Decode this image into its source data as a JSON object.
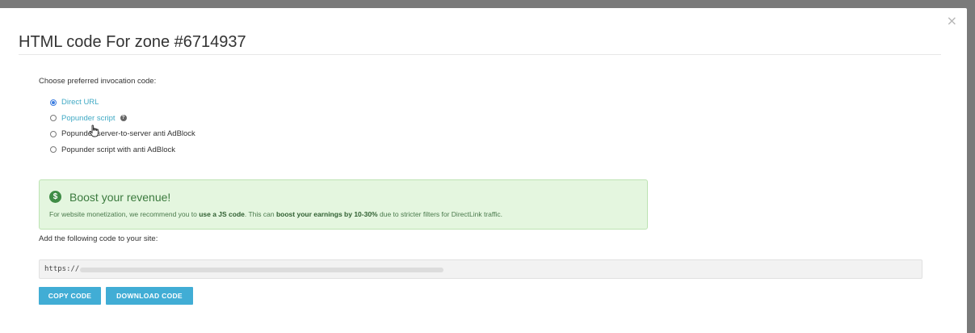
{
  "modal": {
    "title": "HTML code For zone #6714937",
    "close_label": "×"
  },
  "invocation": {
    "label": "Choose preferred invocation code:",
    "options": [
      {
        "label": "Direct URL",
        "selected": true
      },
      {
        "label": "Popunder script",
        "selected": false,
        "help": "?"
      },
      {
        "label": "Popunder server-to-server anti AdBlock",
        "selected": false
      },
      {
        "label": "Popunder script with anti AdBlock",
        "selected": false
      }
    ]
  },
  "alert": {
    "icon": "$",
    "title": "Boost your revenue!",
    "text_1": "For website monetization, we recommend you to ",
    "bold_1": "use a JS code",
    "text_2": ". This can ",
    "bold_2": "boost your earnings by 10-30%",
    "text_3": " due to stricter filters for DirectLink traffic."
  },
  "code": {
    "label": "Add the following code to your site:",
    "prefix": "https://"
  },
  "buttons": {
    "copy": "COPY CODE",
    "download": "DOWNLOAD CODE"
  },
  "colors": {
    "accent": "#41add5",
    "radio_selected": "#3c7de0",
    "alert_bg": "#e4f6df"
  }
}
